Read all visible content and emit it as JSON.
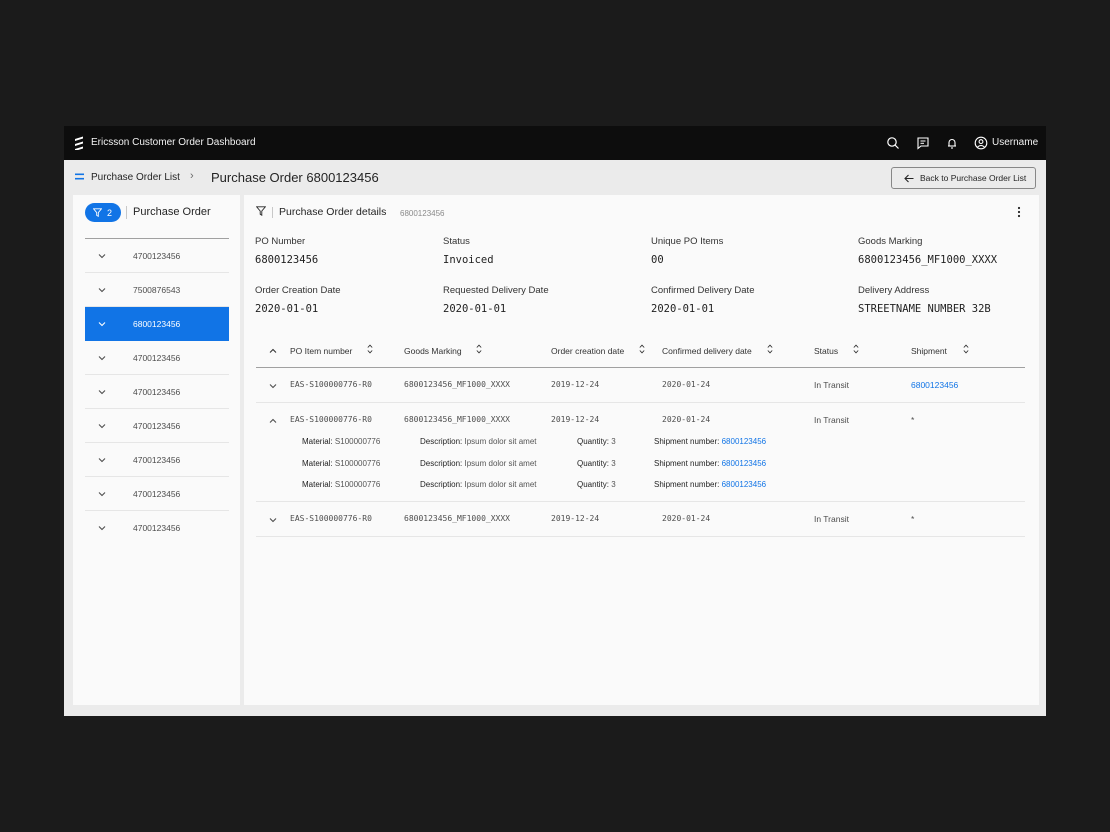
{
  "topbar": {
    "app_title": "Ericsson Customer Order Dashboard",
    "user": "Username",
    "icons": [
      "search-icon",
      "chat-icon",
      "bell-icon",
      "user-icon"
    ]
  },
  "breadcrumb": {
    "parent": "Purchase Order List",
    "separator": "›",
    "current": "Purchase Order 6800123456",
    "back_label": "Back to Purchase Order List"
  },
  "left_panel": {
    "filter_count": "2",
    "title": "Purchase Order",
    "items": [
      {
        "number": "4700123456"
      },
      {
        "number": "7500876543"
      },
      {
        "number": "6800123456",
        "selected": true
      },
      {
        "number": "4700123456"
      },
      {
        "number": "4700123456"
      },
      {
        "number": "4700123456"
      },
      {
        "number": "4700123456"
      },
      {
        "number": "4700123456"
      },
      {
        "number": "4700123456"
      }
    ]
  },
  "details": {
    "title": "Purchase Order details",
    "subtitle": "6800123456",
    "fields": [
      {
        "label": "PO Number",
        "value": "6800123456"
      },
      {
        "label": "Status",
        "value": "Invoiced"
      },
      {
        "label": "Unique PO Items",
        "value": "00"
      },
      {
        "label": "Goods Marking",
        "value": "6800123456_MF1000_XXXX"
      },
      {
        "label": "Order Creation Date",
        "value": "2020-01-01"
      },
      {
        "label": "Requested Delivery Date",
        "value": "2020-01-01"
      },
      {
        "label": "Confirmed Delivery Date",
        "value": "2020-01-01"
      },
      {
        "label": "Delivery Address",
        "value": "STREETNAME NUMBER 32B"
      }
    ]
  },
  "table": {
    "columns": [
      "PO Item number",
      "Goods Marking",
      "Order creation date",
      "Confirmed delivery date",
      "Status",
      "Shipment"
    ],
    "rows": [
      {
        "item": "EAS-S100000776-R0",
        "goods": "6800123456_MF1000_XXXX",
        "created": "2019-12-24",
        "confirmed": "2020-01-24",
        "status": "In Transit",
        "shipment": "6800123456"
      },
      {
        "item": "EAS-S100000776-R0",
        "goods": "6800123456_MF1000_XXXX",
        "created": "2019-12-24",
        "confirmed": "2020-01-24",
        "status": "In Transit",
        "shipment": "*",
        "expanded": [
          {
            "material_label": "Material:",
            "material": "S100000776",
            "desc_label": "Description:",
            "desc": "Ipsum dolor sit amet",
            "qty_label": "Quantity:",
            "qty": "3",
            "ship_label": "Shipment number:",
            "ship": "6800123456"
          },
          {
            "material_label": "Material:",
            "material": "S100000776",
            "desc_label": "Description:",
            "desc": "Ipsum dolor sit amet",
            "qty_label": "Quantity:",
            "qty": "3",
            "ship_label": "Shipment number:",
            "ship": "6800123456"
          },
          {
            "material_label": "Material:",
            "material": "S100000776",
            "desc_label": "Description:",
            "desc": "Ipsum dolor sit amet",
            "qty_label": "Quantity:",
            "qty": "3",
            "ship_label": "Shipment number:",
            "ship": "6800123456"
          }
        ]
      },
      {
        "item": "EAS-S100000776-R0",
        "goods": "6800123456_MF1000_XXXX",
        "created": "2019-12-24",
        "confirmed": "2020-01-24",
        "status": "In Transit",
        "shipment": "*"
      }
    ]
  },
  "colors": {
    "accent": "#1174e6",
    "topbar": "#0d0d0d",
    "surface": "#fafafa",
    "background": "#ebebeb"
  }
}
